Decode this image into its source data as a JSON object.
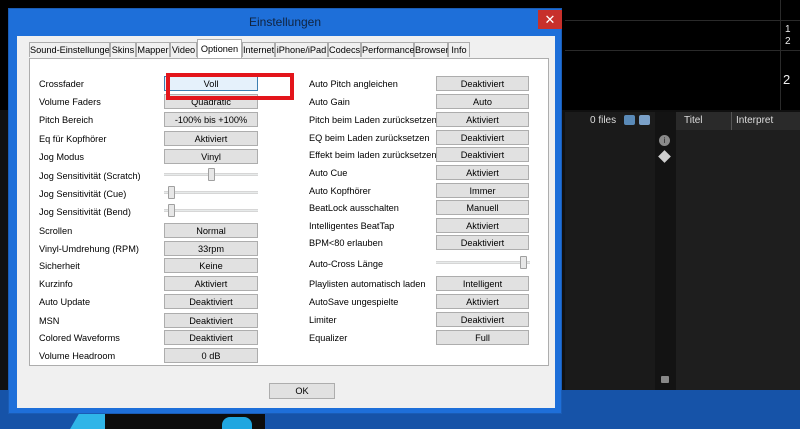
{
  "background": {
    "numbers": [
      "1",
      "2",
      "2"
    ],
    "files": "0 files",
    "columns": [
      "Titel",
      "Interpret"
    ]
  },
  "dialog": {
    "title": "Einstellungen",
    "close_glyph": "✕",
    "ok_label": "OK"
  },
  "tabs": [
    {
      "label": "Sound-Einstellungen"
    },
    {
      "label": "Skins"
    },
    {
      "label": "Mapper"
    },
    {
      "label": "Video"
    },
    {
      "label": "Optionen"
    },
    {
      "label": "Internet"
    },
    {
      "label": "iPhone/iPad"
    },
    {
      "label": "Codecs"
    },
    {
      "label": "Performance"
    },
    {
      "label": "Browser"
    },
    {
      "label": "Info"
    }
  ],
  "active_tab": "Optionen",
  "left": [
    {
      "label": "Crossfader",
      "value": "Voll"
    },
    {
      "label": "Volume Faders",
      "value": "Quadratic"
    },
    {
      "label": "Pitch Bereich",
      "value": "-100% bis +100%"
    },
    {
      "label": "Eq für Kopfhörer",
      "value": "Aktiviert"
    },
    {
      "label": "Jog Modus",
      "value": "Vinyl"
    },
    {
      "label": "Jog Sensitivität (Scratch)",
      "slider": 0.5
    },
    {
      "label": "Jog Sensitivität (Cue)",
      "slider": 0.05
    },
    {
      "label": "Jog Sensitivität (Bend)",
      "slider": 0.05
    },
    {
      "label": "Scrollen",
      "value": "Normal"
    },
    {
      "label": "Vinyl-Umdrehung (RPM)",
      "value": "33rpm"
    },
    {
      "label": "Sicherheit",
      "value": "Keine"
    },
    {
      "label": "Kurzinfo",
      "value": "Aktiviert"
    },
    {
      "label": "Auto Update",
      "value": "Deaktiviert"
    },
    {
      "label": "MSN",
      "value": "Deaktiviert"
    },
    {
      "label": "Colored Waveforms",
      "value": "Deaktiviert"
    },
    {
      "label": "Volume Headroom",
      "value": "0 dB"
    }
  ],
  "right": [
    {
      "label": "Auto Pitch angleichen",
      "value": "Deaktiviert"
    },
    {
      "label": "Auto Gain",
      "value": "Auto"
    },
    {
      "label": "Pitch beim Laden zurücksetzen",
      "value": "Aktiviert"
    },
    {
      "label": "EQ beim Laden zurücksetzen",
      "value": "Deaktiviert"
    },
    {
      "label": "Effekt beim laden zurücksetzen",
      "value": "Deaktiviert"
    },
    {
      "label": "Auto Cue",
      "value": "Aktiviert"
    },
    {
      "label": "Auto Kopfhörer",
      "value": "Immer"
    },
    {
      "label": "BeatLock ausschalten",
      "value": "Manuell"
    },
    {
      "label": "Intelligentes BeatTap",
      "value": "Aktiviert"
    },
    {
      "label": "BPM<80 erlauben",
      "value": "Deaktiviert"
    },
    {
      "label": "Auto-Cross Länge",
      "slider": 0.97
    },
    {
      "label": "Playlisten automatisch laden",
      "value": "Intelligent"
    },
    {
      "label": "AutoSave ungespielte",
      "value": "Aktiviert"
    },
    {
      "label": "Limiter",
      "value": "Deaktiviert"
    },
    {
      "label": "Equalizer",
      "value": "Full"
    }
  ]
}
